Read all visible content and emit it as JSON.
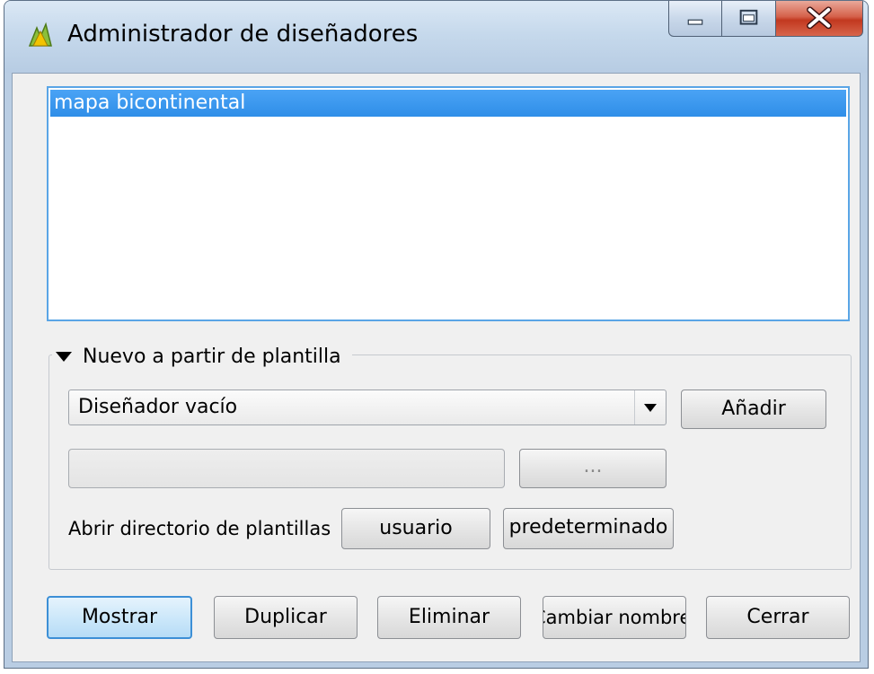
{
  "window": {
    "title": "Administrador de diseñadores"
  },
  "designer_list": {
    "items": [
      "mapa bicontinental"
    ],
    "selected_index": 0
  },
  "template_group": {
    "label": "Nuevo a partir de plantilla",
    "expanded": true,
    "combo_value": "Diseñador vacío",
    "add_label": "Añadir",
    "file_path_value": "",
    "browse_label": "...",
    "open_dir_label": "Abrir directorio de plantillas",
    "user_label": "usuario",
    "default_label": "predeterminado"
  },
  "buttons": {
    "show": "Mostrar",
    "duplicate": "Duplicar",
    "delete": "Eliminar",
    "rename": "Cambiar nombre",
    "close": "Cerrar"
  }
}
